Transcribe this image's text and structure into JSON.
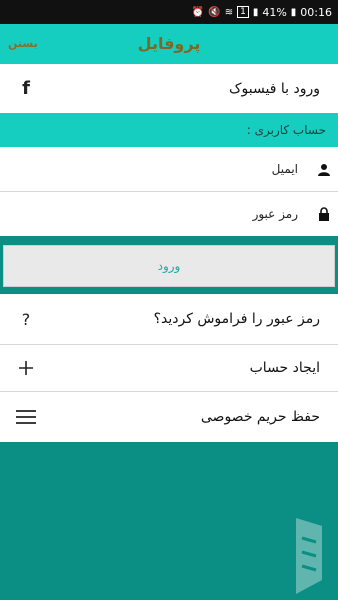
{
  "status_bar": {
    "battery": "41%",
    "time": "00:16",
    "notification_count": "1"
  },
  "app_bar": {
    "title": "پروفایل",
    "close_label": "بستن"
  },
  "facebook_login": {
    "label": "ورود با فیسبوک",
    "icon": "facebook-icon"
  },
  "account_section": {
    "title": "حساب کاربری :"
  },
  "email_field": {
    "placeholder": "ایمیل",
    "icon": "user-icon"
  },
  "password_field": {
    "placeholder": "رمز عبور",
    "icon": "lock-icon"
  },
  "login_button": {
    "label": "ورود"
  },
  "menu": {
    "forgot_password": {
      "label": "رمز عبور را فراموش کردید؟",
      "icon": "question-icon"
    },
    "create_account": {
      "label": "ایجاد حساب",
      "icon": "plus-icon"
    },
    "privacy": {
      "label": "حفظ حریم خصوصی",
      "icon": "menu-icon"
    }
  },
  "colors": {
    "accent": "#16cec0",
    "background": "#0b8f85",
    "title": "#7a6a2a",
    "login_text": "#22a89c"
  }
}
